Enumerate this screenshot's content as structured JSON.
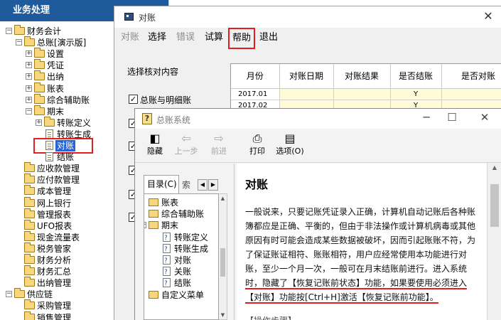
{
  "left_panel": {
    "title": "业务处理",
    "tree": [
      {
        "label": "财务会计",
        "icon": "folder-icon",
        "toggle": "−",
        "depth": 0
      },
      {
        "label": "总账[演示版]",
        "icon": "folder-icon",
        "toggle": "−",
        "depth": 1
      },
      {
        "label": "设置",
        "icon": "folder-icon",
        "toggle": "+",
        "depth": 2
      },
      {
        "label": "凭证",
        "icon": "folder-icon",
        "toggle": "+",
        "depth": 2
      },
      {
        "label": "出纳",
        "icon": "folder-icon",
        "toggle": "+",
        "depth": 2
      },
      {
        "label": "账表",
        "icon": "folder-icon",
        "toggle": "+",
        "depth": 2
      },
      {
        "label": "综合辅助账",
        "icon": "folder-icon",
        "toggle": "+",
        "depth": 2
      },
      {
        "label": "期末",
        "icon": "folder-icon",
        "toggle": "−",
        "depth": 2
      },
      {
        "label": "转账定义",
        "icon": "folder-icon",
        "toggle": "+",
        "depth": 3
      },
      {
        "label": "转账生成",
        "icon": "document-icon",
        "toggle": "",
        "depth": 3
      },
      {
        "label": "对账",
        "icon": "document-icon",
        "toggle": "",
        "depth": 3,
        "selected": true
      },
      {
        "label": "结账",
        "icon": "document-icon",
        "toggle": "",
        "depth": 3
      },
      {
        "label": "应收款管理",
        "icon": "folder-icon",
        "toggle": "",
        "depth": 1
      },
      {
        "label": "应付款管理",
        "icon": "folder-icon",
        "toggle": "",
        "depth": 1
      },
      {
        "label": "成本管理",
        "icon": "folder-icon",
        "toggle": "",
        "depth": 1
      },
      {
        "label": "网上银行",
        "icon": "folder-icon",
        "toggle": "",
        "depth": 1
      },
      {
        "label": "管理报表",
        "icon": "folder-icon",
        "toggle": "",
        "depth": 1
      },
      {
        "label": "UFO报表",
        "icon": "folder-icon",
        "toggle": "",
        "depth": 1
      },
      {
        "label": "现金流量表",
        "icon": "folder-icon",
        "toggle": "",
        "depth": 1
      },
      {
        "label": "税务管家",
        "icon": "folder-icon",
        "toggle": "",
        "depth": 1
      },
      {
        "label": "财务分析",
        "icon": "folder-icon",
        "toggle": "",
        "depth": 1
      },
      {
        "label": "财务汇总",
        "icon": "folder-icon",
        "toggle": "",
        "depth": 1
      },
      {
        "label": "出纳管理",
        "icon": "folder-icon",
        "toggle": "",
        "depth": 1
      },
      {
        "label": "供应链",
        "icon": "folder-icon",
        "toggle": "−",
        "depth": 0
      },
      {
        "label": "采购管理",
        "icon": "folder-icon",
        "toggle": "",
        "depth": 1
      },
      {
        "label": "销售管理",
        "icon": "folder-icon",
        "toggle": "",
        "depth": 1
      }
    ]
  },
  "duizhang_window": {
    "title": "对账",
    "close_glyph": "✕",
    "menu": [
      {
        "label": "对账",
        "disabled": true
      },
      {
        "label": "选择",
        "disabled": false
      },
      {
        "label": "错误",
        "disabled": true
      },
      {
        "label": "试算",
        "disabled": false
      },
      {
        "label": "帮助",
        "disabled": false,
        "highlighted": true
      },
      {
        "label": "退出",
        "disabled": false
      }
    ],
    "options_label": "选择核对内容",
    "options": [
      {
        "label": "总账与明细账",
        "checked": true
      },
      {
        "label": "",
        "checked": true
      },
      {
        "label": "",
        "checked": true
      },
      {
        "label": "",
        "checked": true
      },
      {
        "label": "",
        "checked": true
      },
      {
        "label": "",
        "checked": true
      }
    ],
    "grid": {
      "headers": [
        "月份",
        "对账日期",
        "对账结果",
        "是否结账",
        "是否对账"
      ],
      "rows": [
        [
          "2017.01",
          "",
          "",
          "Y",
          ""
        ],
        [
          "2017.02",
          "",
          "",
          "Y",
          ""
        ]
      ]
    }
  },
  "help_window": {
    "title": "总账系统",
    "window_controls": [
      "─",
      "☐",
      "✕"
    ],
    "toolbar": [
      {
        "label": "隐藏",
        "icon": "hide-icon",
        "glyph": "◧",
        "disabled": false
      },
      {
        "label": "上一步",
        "icon": "back-arrow-icon",
        "glyph": "⇦",
        "disabled": true
      },
      {
        "label": "前进",
        "icon": "forward-arrow-icon",
        "glyph": "⇨",
        "disabled": true
      },
      {
        "label": "打印",
        "icon": "printer-icon",
        "glyph": "⎙",
        "disabled": false
      },
      {
        "label": "选项(O)",
        "icon": "options-icon",
        "glyph": "▤",
        "disabled": false
      }
    ],
    "tabs": {
      "selected": "目录(C)",
      "next": "索",
      "left_arrow": "◀",
      "right_arrow": "▶"
    },
    "tree": [
      {
        "label": "账表",
        "icon": "folder-icon",
        "toggle": "",
        "depth": 0
      },
      {
        "label": "综合辅助账",
        "icon": "folder-icon",
        "toggle": "",
        "depth": 0
      },
      {
        "label": "期末",
        "icon": "folder-icon",
        "toggle": "−",
        "depth": 0
      },
      {
        "label": "转账定义",
        "icon": "help-topic-icon",
        "toggle": "",
        "depth": 1
      },
      {
        "label": "转账生成",
        "icon": "help-topic-icon",
        "toggle": "",
        "depth": 1
      },
      {
        "label": "对账",
        "icon": "help-topic-icon",
        "toggle": "",
        "depth": 1
      },
      {
        "label": "关账",
        "icon": "help-topic-icon",
        "toggle": "",
        "depth": 1
      },
      {
        "label": "结账",
        "icon": "help-topic-icon",
        "toggle": "",
        "depth": 1
      },
      {
        "label": "自定义菜单",
        "icon": "folder-icon",
        "toggle": "",
        "depth": 0
      }
    ],
    "content": {
      "title": "对账",
      "lines": [
        "一般说来，只要记账凭证录入正确，计算机自动记账后各种账",
        "簿都应是正确、平衡的，但由于非法操作或计算机病毒或其他",
        "原因有时可能会造成某些数据被破坏，因而引起账账不符，为",
        "了保证账证相符、账账相符，用户应经常使用本功能进行对",
        "账，至少一个月一次，一般可在月末结账前进行。进入系统",
        "时，隐藏了【恢复记账前状态】功能，如果要使用必须进入",
        "【对账】功能按[Ctrl+H]激活【恢复记账前功能】。"
      ],
      "footer": "【操作步骤】"
    }
  }
}
